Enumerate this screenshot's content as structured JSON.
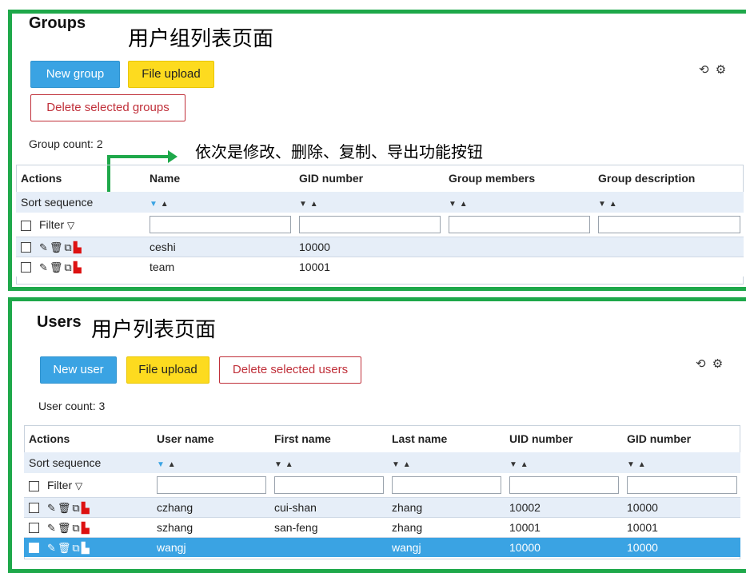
{
  "colors": {
    "annotation_border": "#1ea84a",
    "primary": "#3aa3e3",
    "upload": "#fddb1f",
    "danger": "#c0303a"
  },
  "groups": {
    "title": "Groups",
    "annotation": "用户组列表页面",
    "new_label": "New group",
    "upload_label": "File upload",
    "delete_label": "Delete selected groups",
    "count_label": "Group count: 2",
    "callout": "依次是修改、删除、复制、导出功能按钮",
    "columns": [
      "Actions",
      "Name",
      "GID number",
      "Group members",
      "Group description"
    ],
    "sort_label": "Sort sequence",
    "filter_label": "Filter",
    "rows": [
      {
        "name": "ceshi",
        "gid": "10000",
        "members": "",
        "description": ""
      },
      {
        "name": "team",
        "gid": "10001",
        "members": "",
        "description": ""
      }
    ]
  },
  "users": {
    "title": "Users",
    "annotation": "用户列表页面",
    "new_label": "New user",
    "upload_label": "File upload",
    "delete_label": "Delete selected users",
    "count_label": "User count: 3",
    "columns": [
      "Actions",
      "User name",
      "First name",
      "Last name",
      "UID number",
      "GID number"
    ],
    "sort_label": "Sort sequence",
    "filter_label": "Filter",
    "rows": [
      {
        "username": "czhang",
        "first": "cui-shan",
        "last": "zhang",
        "uid": "10002",
        "gid": "10000",
        "selected": false
      },
      {
        "username": "szhang",
        "first": "san-feng",
        "last": "zhang",
        "uid": "10001",
        "gid": "10001",
        "selected": false
      },
      {
        "username": "wangj",
        "first": "",
        "last": "wangj",
        "uid": "10000",
        "gid": "10000",
        "selected": true
      }
    ]
  },
  "icons": [
    "refresh-icon",
    "gear-icon",
    "edit-icon",
    "delete-icon",
    "copy-icon",
    "pdf-export-icon",
    "filter-icon",
    "sort-down-icon",
    "sort-up-icon"
  ]
}
